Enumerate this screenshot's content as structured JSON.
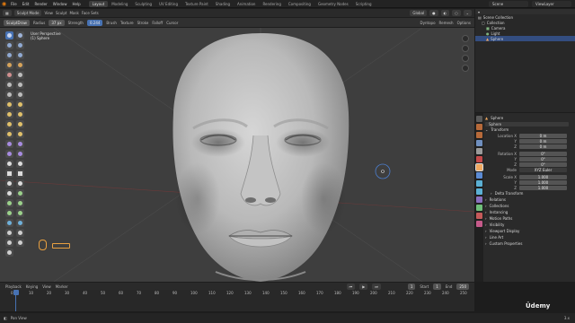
{
  "menu": [
    "File",
    "Edit",
    "Render",
    "Window",
    "Help"
  ],
  "workspaces": [
    "Layout",
    "Modeling",
    "Sculpting",
    "UV Editing",
    "Texture Paint",
    "Shading",
    "Animation",
    "Rendering",
    "Compositing",
    "Geometry Nodes",
    "Scripting"
  ],
  "active_workspace": "Layout",
  "scene": {
    "label": "Scene",
    "view_layer": "ViewLayer"
  },
  "header": {
    "mode": "Sculpt Mode",
    "items": [
      "View",
      "Sculpt",
      "Mask",
      "Face Sets"
    ],
    "right": [
      "Brush",
      "Texture",
      "Stroke",
      "Falloff",
      "Cursor"
    ],
    "global": "Global",
    "options": "Options"
  },
  "tool_header": {
    "brush_name": "SculptDraw",
    "radius_label": "Radius",
    "radius_value": "37 px",
    "strength_label": "Strength",
    "strength_value": "0.244",
    "dyntopo": "Dyntopo",
    "remesh": "Remesh"
  },
  "viewport": {
    "view_name": "User Perspective",
    "object_name": "(1) Sphere"
  },
  "outliner": {
    "title": "Scene Collection",
    "items": [
      {
        "label": "Collection",
        "indent": 1
      },
      {
        "label": "Camera",
        "indent": 2
      },
      {
        "label": "Light",
        "indent": 2
      },
      {
        "label": "Sphere",
        "indent": 2
      }
    ]
  },
  "properties": {
    "object": "Sphere",
    "object_field": "Sphere",
    "transform_label": "Transform",
    "location_label": "Location X",
    "location": [
      "0 m",
      "0 m",
      "0 m"
    ],
    "rotation_label": "Rotation X",
    "rotation": [
      "0°",
      "0°",
      "0°"
    ],
    "mode_label": "Mode",
    "mode_value": "XYZ Euler",
    "scale_label": "Scale X",
    "scale": [
      "1.000",
      "1.000",
      "1.000"
    ],
    "axis_labels": [
      "Y",
      "Z"
    ],
    "sections": [
      "Delta Transform",
      "Relations",
      "Collections",
      "Instancing",
      "Motion Paths",
      "Visibility",
      "Viewport Display",
      "Line Art",
      "Custom Properties"
    ]
  },
  "timeline": {
    "menu": [
      "Playback",
      "Keying",
      "View",
      "Marker"
    ],
    "current_frame": "1",
    "start_label": "Start",
    "start": "1",
    "end_label": "End",
    "end": "250",
    "ticks": [
      "0",
      "10",
      "20",
      "30",
      "40",
      "50",
      "60",
      "70",
      "80",
      "90",
      "100",
      "110",
      "120",
      "130",
      "140",
      "150",
      "160",
      "170",
      "180",
      "190",
      "200",
      "210",
      "220",
      "230",
      "240",
      "250"
    ]
  },
  "status": {
    "left": "Pan View",
    "version": "3.x"
  },
  "watermark": "Ūdemy",
  "colors": {
    "accent": "#4772b3",
    "brand": "#e87d0d"
  }
}
